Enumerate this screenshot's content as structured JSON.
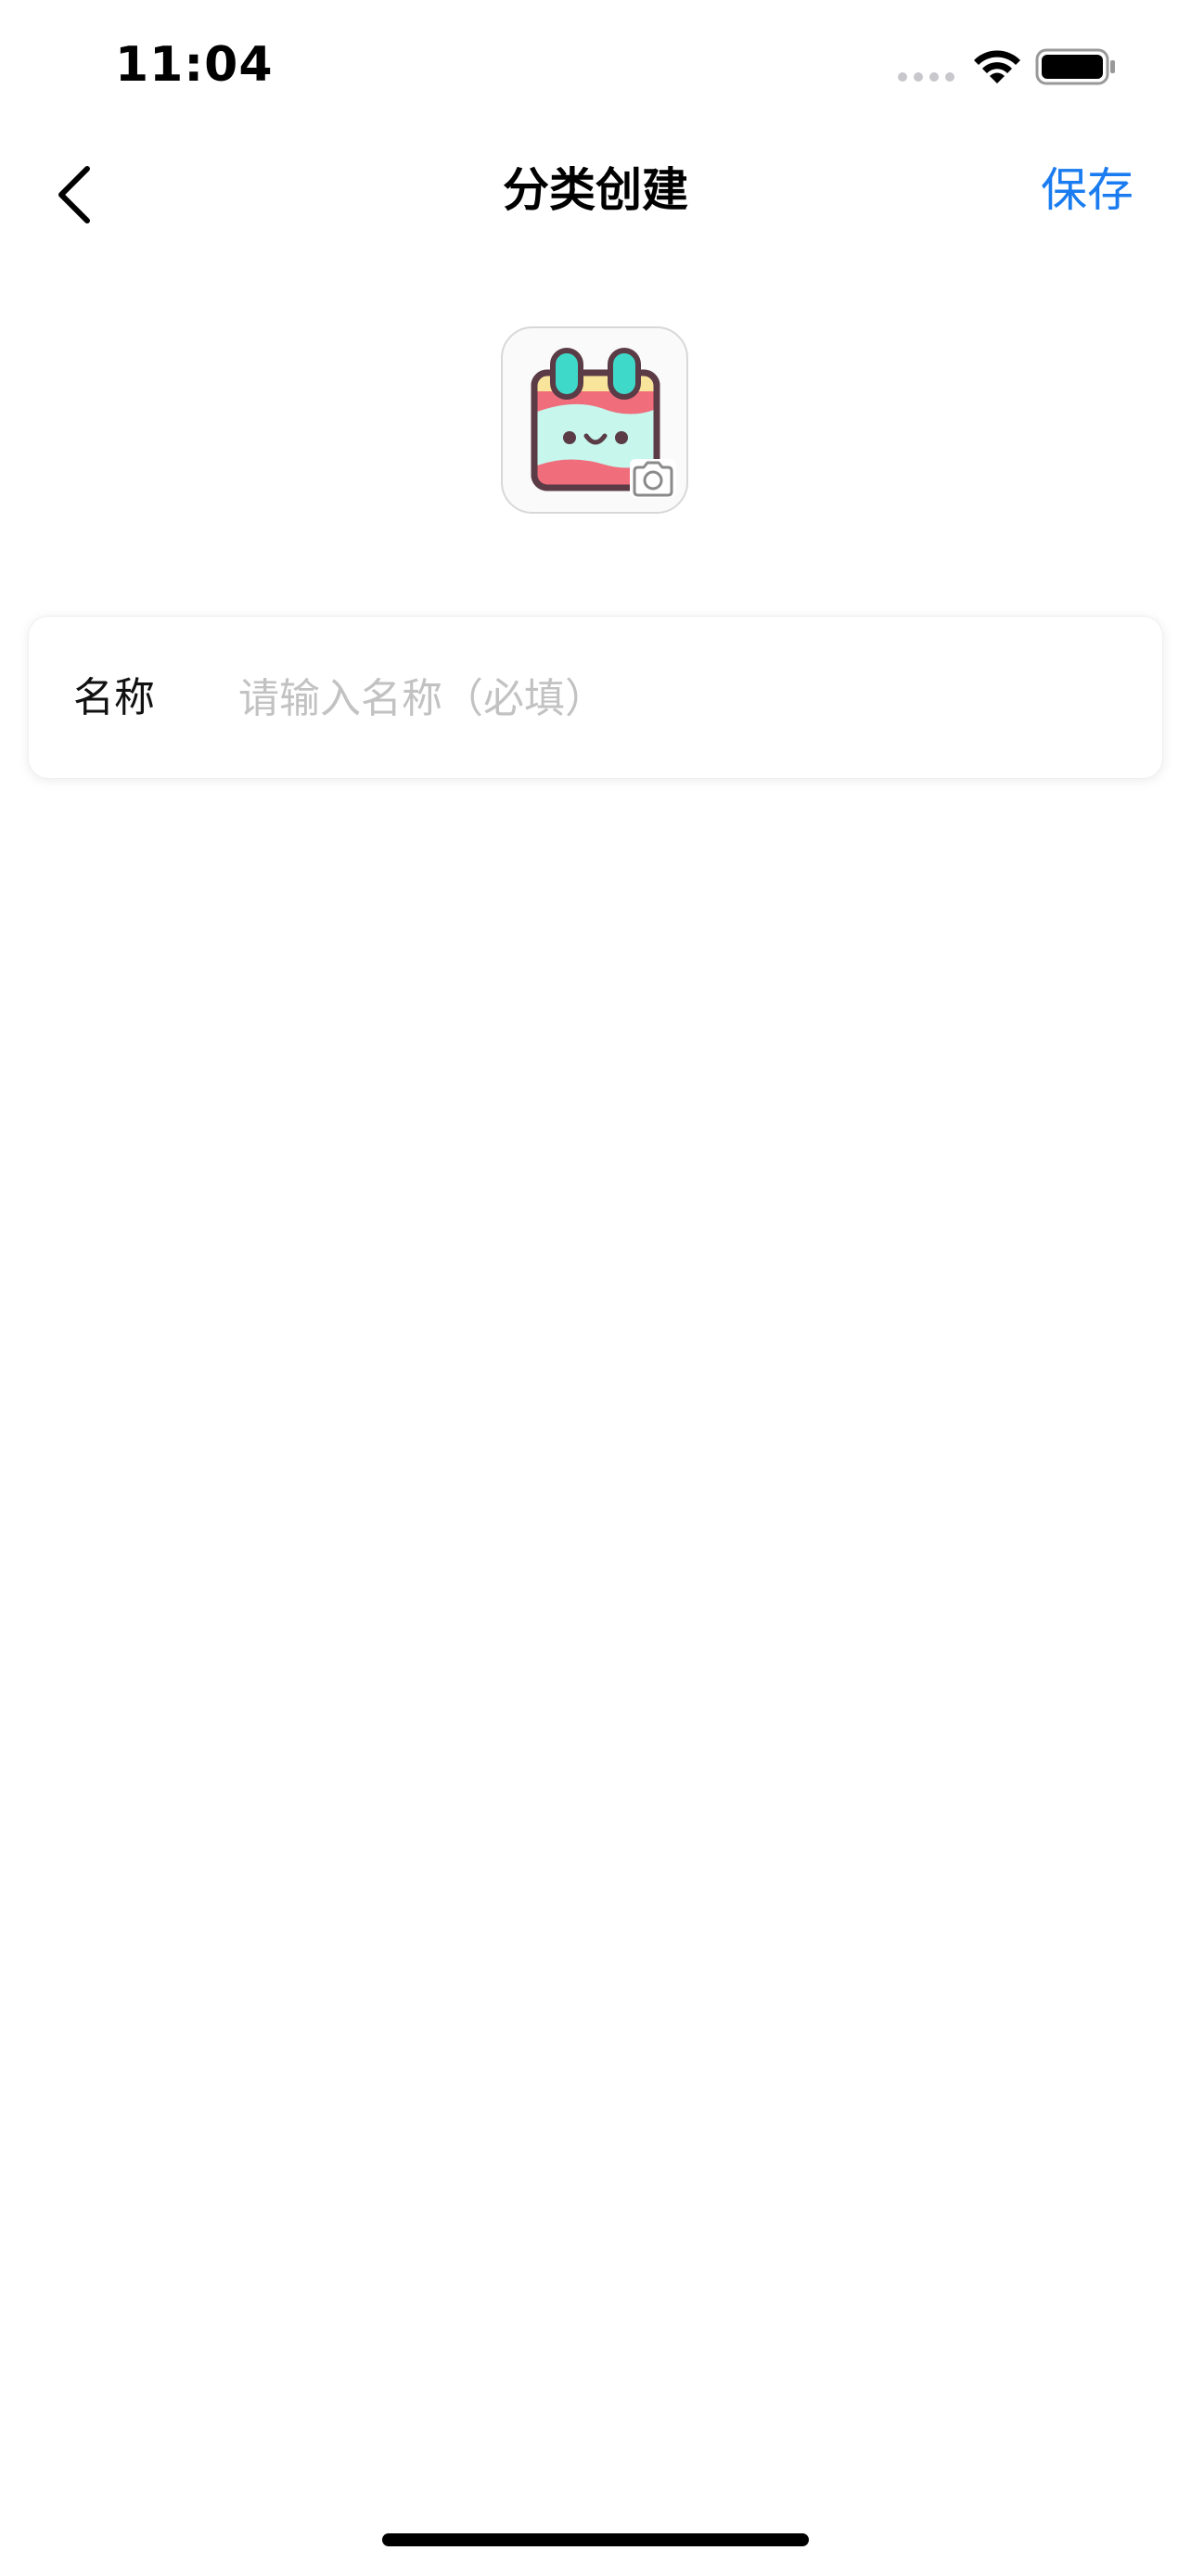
{
  "status_bar": {
    "time": "11:04",
    "icons": [
      "signal-dots-icon",
      "wifi-icon",
      "battery-icon"
    ]
  },
  "nav": {
    "title": "分类创建",
    "save_label": "保存",
    "back_icon": "chevron-left-icon"
  },
  "category_icon": {
    "icon": "notebook-face-icon",
    "badge_icon": "camera-icon"
  },
  "form": {
    "name_label": "名称",
    "name_value": "",
    "name_placeholder": "请输入名称（必填）"
  },
  "colors": {
    "accent": "#1a7cf0",
    "placeholder": "#c2c2c2",
    "icon_teal": "#3fd9c9",
    "icon_pink": "#f06d7c",
    "icon_yellow": "#f9e49b",
    "icon_mint": "#c6f6ec",
    "icon_outline": "#5a3b46"
  }
}
